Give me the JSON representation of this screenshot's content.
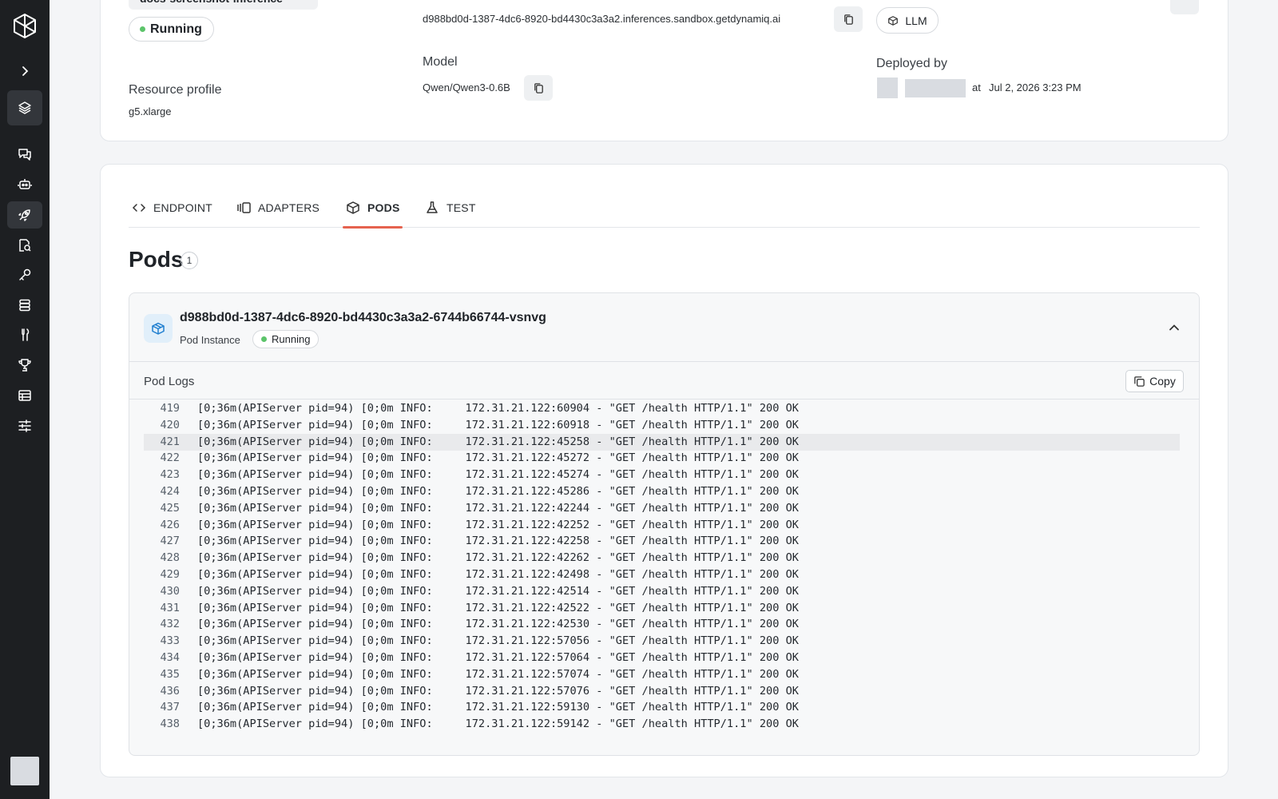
{
  "sidebar": {
    "items": [
      {
        "icon": "chevron-right-icon"
      },
      {
        "icon": "layers-icon"
      },
      {
        "icon": "chat-icon"
      },
      {
        "icon": "bot-icon"
      },
      {
        "icon": "rocket-icon"
      },
      {
        "icon": "document-search-icon"
      },
      {
        "icon": "key-icon"
      },
      {
        "icon": "database-icon"
      },
      {
        "icon": "tools-icon"
      },
      {
        "icon": "trophy-icon"
      },
      {
        "icon": "table-icon"
      },
      {
        "icon": "sliders-icon"
      }
    ]
  },
  "deployment": {
    "name": "docs-screenshot-inference",
    "status": "Running",
    "endpoint": "d988bd0d-1387-4dc6-8920-bd4430c3a3a2.inferences.sandbox.getdynamiq.ai",
    "type": "LLM",
    "model_label": "Model",
    "model": "Qwen/Qwen3-0.6B",
    "resource_profile_label": "Resource profile",
    "resource_profile": "g5.xlarge",
    "deployed_by_label": "Deployed by",
    "deployed_at_prefix": "at",
    "deployed_at": "Jul 2, 2026 3:23 PM"
  },
  "tabs": [
    {
      "label": "ENDPOINT",
      "icon": "code-icon"
    },
    {
      "label": "ADAPTERS",
      "icon": "adapters-icon"
    },
    {
      "label": "PODS",
      "icon": "cube-icon",
      "active": true
    },
    {
      "label": "TEST",
      "icon": "flask-icon"
    }
  ],
  "pods": {
    "title": "Pods",
    "count": "1",
    "items": [
      {
        "name": "d988bd0d-1387-4dc6-8920-bd4430c3a3a2-6744b66744-vsnvg",
        "subtitle": "Pod Instance",
        "status": "Running",
        "logs_title": "Pod Logs",
        "copy_label": "Copy",
        "highlighted_line": "421",
        "logs": [
          {
            "n": "419",
            "text": "[0;36m(APIServer pid=94) [0;0m INFO:     172.31.21.122:60904 - \"GET /health HTTP/1.1\" 200 OK"
          },
          {
            "n": "420",
            "text": "[0;36m(APIServer pid=94) [0;0m INFO:     172.31.21.122:60918 - \"GET /health HTTP/1.1\" 200 OK"
          },
          {
            "n": "421",
            "text": "[0;36m(APIServer pid=94) [0;0m INFO:     172.31.21.122:45258 - \"GET /health HTTP/1.1\" 200 OK"
          },
          {
            "n": "422",
            "text": "[0;36m(APIServer pid=94) [0;0m INFO:     172.31.21.122:45272 - \"GET /health HTTP/1.1\" 200 OK"
          },
          {
            "n": "423",
            "text": "[0;36m(APIServer pid=94) [0;0m INFO:     172.31.21.122:45274 - \"GET /health HTTP/1.1\" 200 OK"
          },
          {
            "n": "424",
            "text": "[0;36m(APIServer pid=94) [0;0m INFO:     172.31.21.122:45286 - \"GET /health HTTP/1.1\" 200 OK"
          },
          {
            "n": "425",
            "text": "[0;36m(APIServer pid=94) [0;0m INFO:     172.31.21.122:42244 - \"GET /health HTTP/1.1\" 200 OK"
          },
          {
            "n": "426",
            "text": "[0;36m(APIServer pid=94) [0;0m INFO:     172.31.21.122:42252 - \"GET /health HTTP/1.1\" 200 OK"
          },
          {
            "n": "427",
            "text": "[0;36m(APIServer pid=94) [0;0m INFO:     172.31.21.122:42258 - \"GET /health HTTP/1.1\" 200 OK"
          },
          {
            "n": "428",
            "text": "[0;36m(APIServer pid=94) [0;0m INFO:     172.31.21.122:42262 - \"GET /health HTTP/1.1\" 200 OK"
          },
          {
            "n": "429",
            "text": "[0;36m(APIServer pid=94) [0;0m INFO:     172.31.21.122:42498 - \"GET /health HTTP/1.1\" 200 OK"
          },
          {
            "n": "430",
            "text": "[0;36m(APIServer pid=94) [0;0m INFO:     172.31.21.122:42514 - \"GET /health HTTP/1.1\" 200 OK"
          },
          {
            "n": "431",
            "text": "[0;36m(APIServer pid=94) [0;0m INFO:     172.31.21.122:42522 - \"GET /health HTTP/1.1\" 200 OK"
          },
          {
            "n": "432",
            "text": "[0;36m(APIServer pid=94) [0;0m INFO:     172.31.21.122:42530 - \"GET /health HTTP/1.1\" 200 OK"
          },
          {
            "n": "433",
            "text": "[0;36m(APIServer pid=94) [0;0m INFO:     172.31.21.122:57056 - \"GET /health HTTP/1.1\" 200 OK"
          },
          {
            "n": "434",
            "text": "[0;36m(APIServer pid=94) [0;0m INFO:     172.31.21.122:57064 - \"GET /health HTTP/1.1\" 200 OK"
          },
          {
            "n": "435",
            "text": "[0;36m(APIServer pid=94) [0;0m INFO:     172.31.21.122:57074 - \"GET /health HTTP/1.1\" 200 OK"
          },
          {
            "n": "436",
            "text": "[0;36m(APIServer pid=94) [0;0m INFO:     172.31.21.122:57076 - \"GET /health HTTP/1.1\" 200 OK"
          },
          {
            "n": "437",
            "text": "[0;36m(APIServer pid=94) [0;0m INFO:     172.31.21.122:59130 - \"GET /health HTTP/1.1\" 200 OK"
          },
          {
            "n": "438",
            "text": "[0;36m(APIServer pid=94) [0;0m INFO:     172.31.21.122:59142 - \"GET /health HTTP/1.1\" 200 OK"
          }
        ]
      }
    ]
  },
  "colors": {
    "sidebar_bg": "#1d1f22",
    "accent_tab_underline": "#e5634f",
    "status_running": "#5cc46a",
    "pod_icon_bg": "#e1effa"
  }
}
